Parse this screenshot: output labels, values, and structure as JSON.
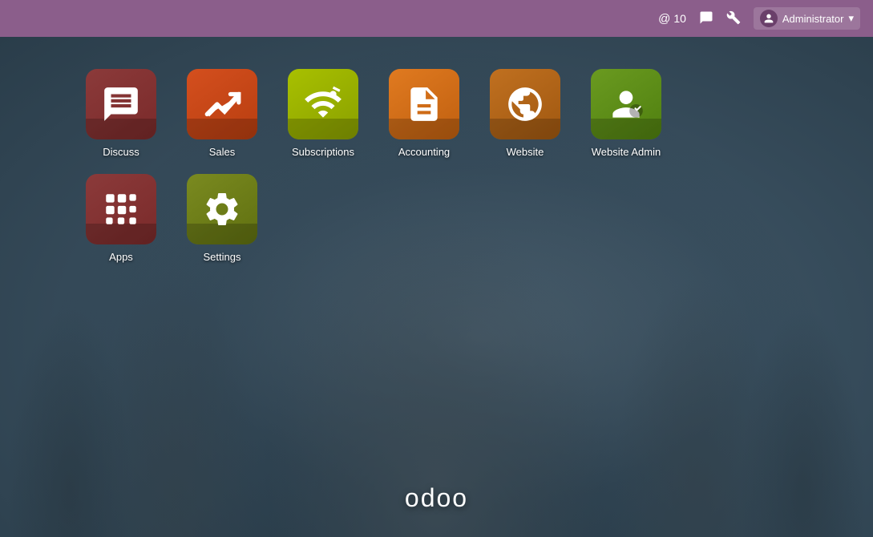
{
  "topbar": {
    "notifications_count": "10",
    "notifications_label": "@ 10",
    "messages_icon": "💬",
    "tools_icon": "🔧",
    "admin_label": "Administrator",
    "admin_dropdown": "▾"
  },
  "apps": {
    "row1": [
      {
        "id": "discuss",
        "label": "Discuss",
        "color_class": "icon-discuss"
      },
      {
        "id": "sales",
        "label": "Sales",
        "color_class": "icon-sales"
      },
      {
        "id": "subscriptions",
        "label": "Subscriptions",
        "color_class": "icon-subscriptions"
      },
      {
        "id": "accounting",
        "label": "Accounting",
        "color_class": "icon-accounting"
      },
      {
        "id": "website",
        "label": "Website",
        "color_class": "icon-website"
      },
      {
        "id": "website-admin",
        "label": "Website Admin",
        "color_class": "icon-website-admin"
      }
    ],
    "row2": [
      {
        "id": "apps",
        "label": "Apps",
        "color_class": "icon-apps"
      },
      {
        "id": "settings",
        "label": "Settings",
        "color_class": "icon-settings"
      }
    ]
  },
  "footer": {
    "logo_text": "odoo"
  }
}
